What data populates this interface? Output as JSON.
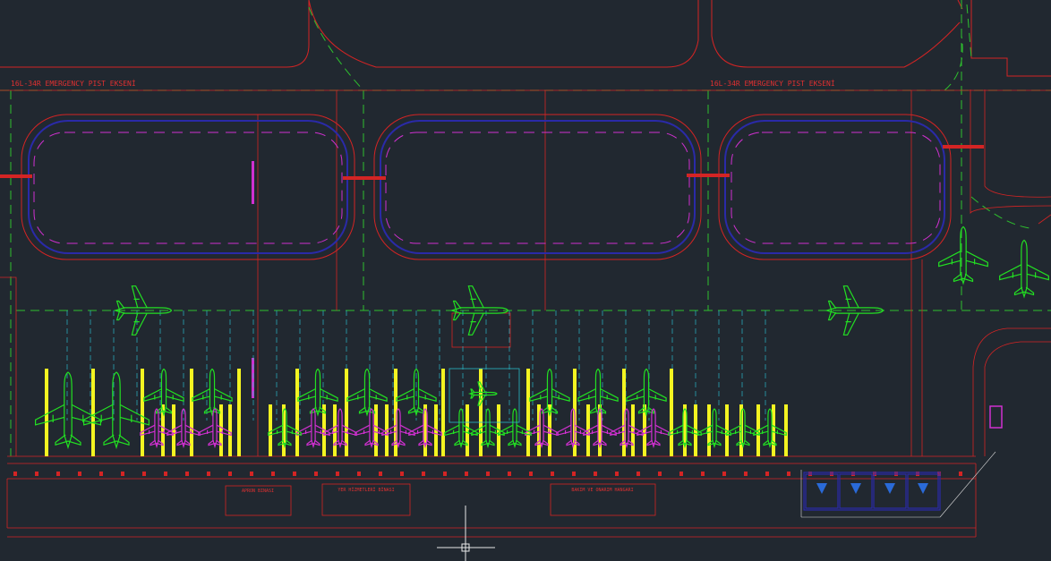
{
  "drawing": {
    "runway_label_left": "16L-34R EMERGENCY PIST EKSENİ",
    "runway_label_right": "16L-34R EMERGENCY PIST EKSENİ",
    "building_labels": [
      "APRON BINASI",
      "YER HİZMETLERİ BİNASI",
      "BAKIM VE ONARIM HANGARI"
    ]
  },
  "colors": {
    "background": "#212830",
    "red": "#d42424",
    "green": "#2ec02e",
    "aircraft": "#22e022",
    "magenta": "#d030d0",
    "blue": "#2a2aa8",
    "yellow": "#f4f421",
    "cyan": "#2ab8c8",
    "white": "#d8d8d8"
  },
  "icons": [
    "aircraft-icon",
    "crosshair-icon",
    "parking-marker-icon"
  ]
}
